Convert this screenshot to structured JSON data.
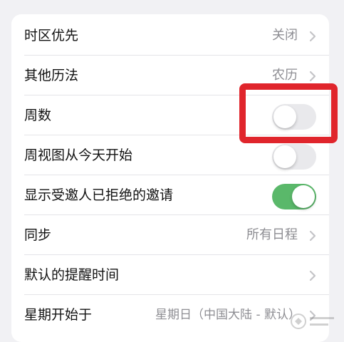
{
  "settings": {
    "rows": [
      {
        "label": "时区优先",
        "value": "关闭",
        "control": "chevron"
      },
      {
        "label": "其他历法",
        "value": "农历",
        "control": "chevron"
      },
      {
        "label": "周数",
        "control": "toggle",
        "on": false
      },
      {
        "label": "周视图从今天开始",
        "control": "toggle",
        "on": false
      },
      {
        "label": "显示受邀人已拒绝的邀请",
        "control": "toggle",
        "on": true
      },
      {
        "label": "同步",
        "value": "所有日程",
        "control": "chevron"
      },
      {
        "label": "默认的提醒时间",
        "value": "",
        "control": "chevron"
      },
      {
        "label": "星期开始于",
        "value": "星期日（中国大陆 - 默认）",
        "control": "chevron"
      }
    ]
  },
  "colors": {
    "toggle_on": "#5ab86a",
    "toggle_off": "#e9e9ec",
    "highlight": "#e0252c"
  },
  "icons": {
    "chevron": "chevron-right-icon"
  }
}
